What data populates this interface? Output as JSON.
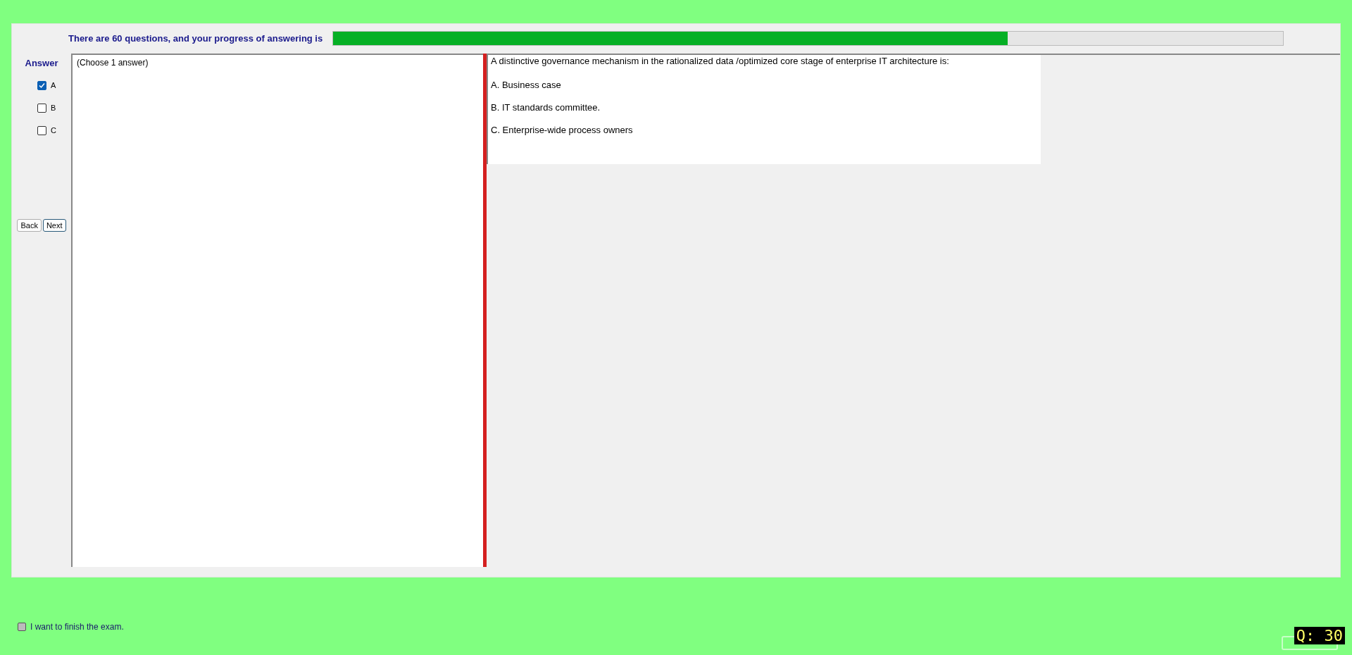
{
  "progress": {
    "label": "There are 60 questions, and your progress of answering is",
    "level": 0.71
  },
  "answer": {
    "title": "Answer",
    "options": [
      {
        "label": "A",
        "checked": true
      },
      {
        "label": "B",
        "checked": false
      },
      {
        "label": "C",
        "checked": false
      }
    ]
  },
  "buttons": [
    {
      "label": "Back",
      "focused": false
    },
    {
      "label": "Next",
      "focused": true
    }
  ],
  "choice_hint": "(Choose 1 answer)",
  "question": {
    "text": "A distinctive governance mechanism in the rationalized data /optimized core stage of enterprise IT architecture is:",
    "choices": [
      "A.  Business case",
      "B.  IT standards committee.",
      "C.  Enterprise-wide process owners"
    ]
  },
  "finish": {
    "label": "I want to finish the exam.",
    "checked": false
  },
  "counter": "Q: 30"
}
